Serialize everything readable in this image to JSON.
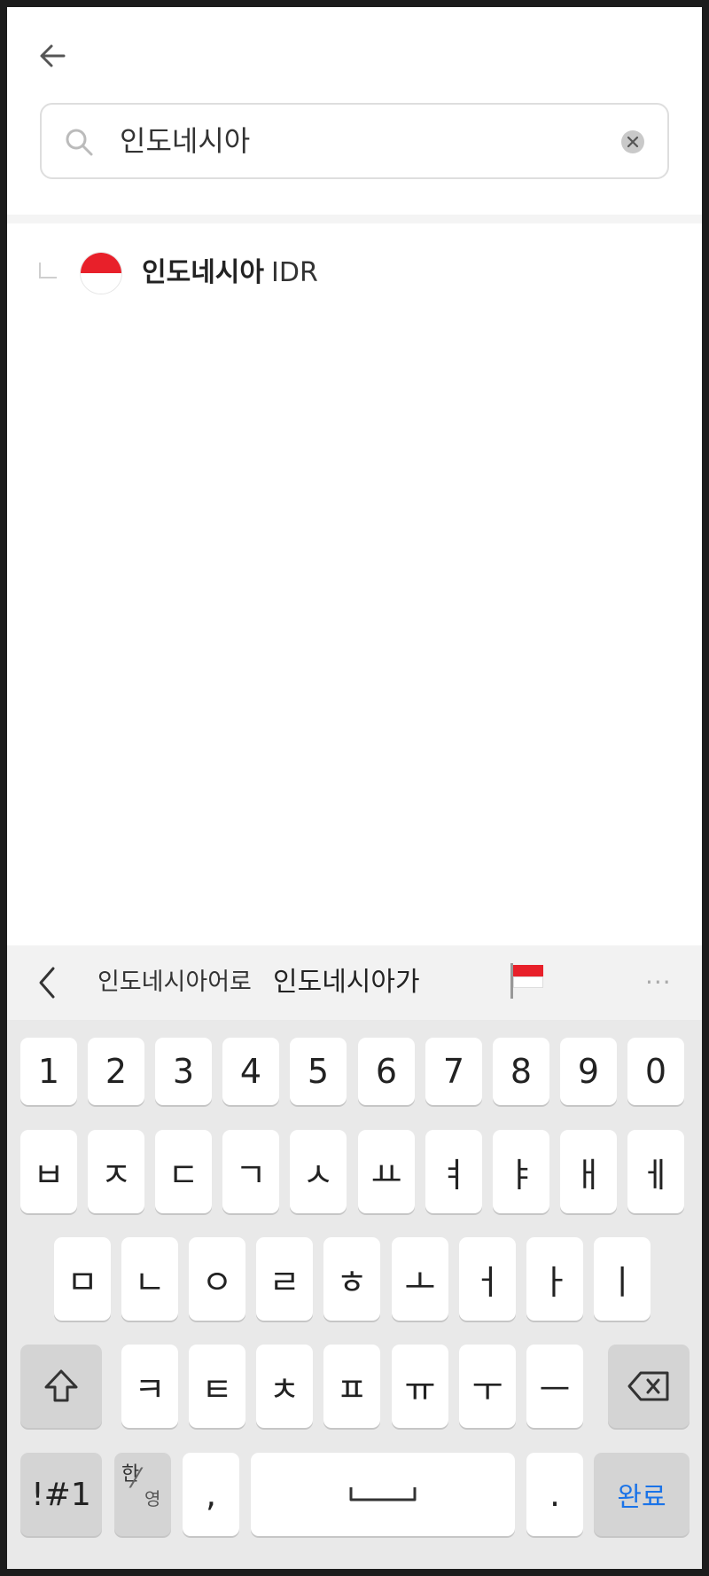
{
  "search": {
    "value": "인도네시아"
  },
  "result": {
    "name": "인도네시아",
    "code": "IDR"
  },
  "suggestions": {
    "word1": "인도네시아어로",
    "word2": "인도네시아가",
    "more": "···"
  },
  "keyboard": {
    "row1": [
      "1",
      "2",
      "3",
      "4",
      "5",
      "6",
      "7",
      "8",
      "9",
      "0"
    ],
    "row2": [
      "ㅂ",
      "ㅈ",
      "ㄷ",
      "ㄱ",
      "ㅅ",
      "ㅛ",
      "ㅕ",
      "ㅑ",
      "ㅐ",
      "ㅔ"
    ],
    "row3": [
      "ㅁ",
      "ㄴ",
      "ㅇ",
      "ㄹ",
      "ㅎ",
      "ㅗ",
      "ㅓ",
      "ㅏ",
      "ㅣ"
    ],
    "row4": [
      "ㅋ",
      "ㅌ",
      "ㅊ",
      "ㅍ",
      "ㅠ",
      "ㅜ",
      "ㅡ"
    ],
    "bottom": {
      "symbols": "!#1",
      "han": "한",
      "yeong": "영",
      "comma": ",",
      "period": ".",
      "done": "완료"
    }
  },
  "colors": {
    "flag_red": "#e8202a",
    "accent": "#1a73e8"
  }
}
